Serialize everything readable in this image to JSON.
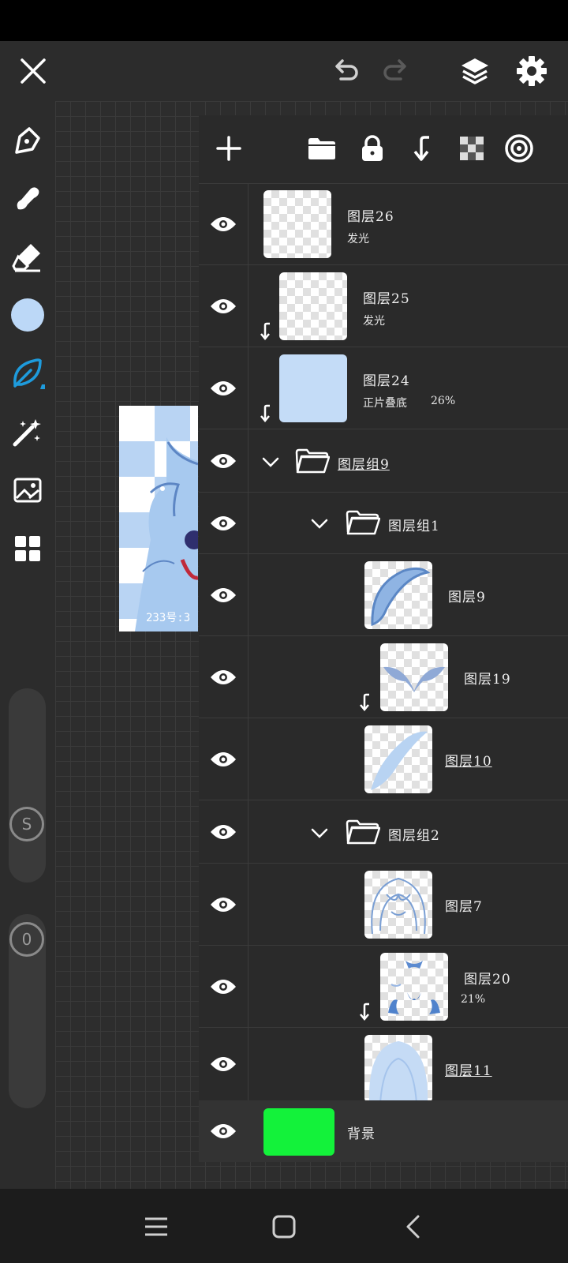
{
  "app": {
    "accent": "#1e9bdc",
    "current_color": "#bcd8f7"
  },
  "icons": {
    "close": "close-icon",
    "undo": "undo-icon",
    "redo": "redo-icon",
    "layers": "layers-icon",
    "settings": "gear-icon"
  },
  "sliders": {
    "size_label": "S",
    "opacity_label": "0"
  },
  "artwork": {
    "watermark": "233号:3"
  },
  "layers": [
    {
      "name": "图层26",
      "sub": "发光"
    },
    {
      "name": "图层25",
      "sub": "发光"
    },
    {
      "name": "图层24",
      "sub": "正片叠底",
      "opacity": "26%"
    },
    {
      "name": "图层组9"
    },
    {
      "name": "图层组1"
    },
    {
      "name": "图层9"
    },
    {
      "name": "图层19"
    },
    {
      "name": "图层10"
    },
    {
      "name": "图层组2"
    },
    {
      "name": "图层7"
    },
    {
      "name": "图层20",
      "sub": "21%"
    },
    {
      "name": "图层11"
    }
  ],
  "background_layer": {
    "name": "背景",
    "color": "#13f23a"
  }
}
